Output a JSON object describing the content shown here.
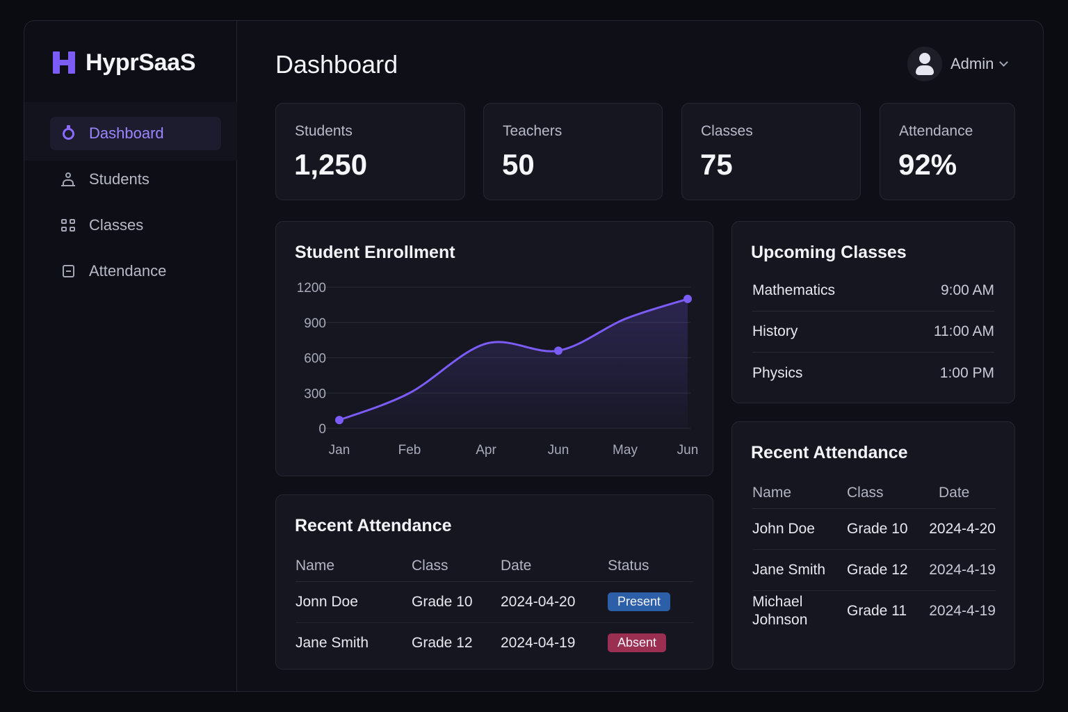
{
  "brand": {
    "name": "HyprSaaS"
  },
  "sidebar": {
    "items": [
      {
        "label": "Dashboard",
        "icon": "dashboard-icon",
        "active": true
      },
      {
        "label": "Students",
        "icon": "user-icon"
      },
      {
        "label": "Classes",
        "icon": "grid-icon"
      },
      {
        "label": "Attendance",
        "icon": "document-icon"
      }
    ]
  },
  "header": {
    "title": "Dashboard",
    "user": "Admin"
  },
  "stats": [
    {
      "label": "Students",
      "value": "1,250"
    },
    {
      "label": "Teachers",
      "value": "50"
    },
    {
      "label": "Classes",
      "value": "75"
    },
    {
      "label": "Attendance",
      "value": "92%"
    }
  ],
  "chart_data": {
    "type": "line",
    "title": "Student Enrollment",
    "categories": [
      "Jan",
      "Feb",
      "Apr",
      "Jun",
      "May",
      "Jun"
    ],
    "values": [
      70,
      300,
      720,
      660,
      930,
      1100
    ],
    "ylim": [
      0,
      1200
    ],
    "yticks": [
      "1200",
      "900",
      "600",
      "300",
      "0"
    ],
    "grid": true,
    "color": "#7c5cf6"
  },
  "recent_attendance_main": {
    "title": "Recent Attendance",
    "columns": [
      "Name",
      "Class",
      "Date",
      "Status"
    ],
    "rows": [
      {
        "name": "Jonn Doe",
        "class": "Grade 10",
        "date": "2024-04-20",
        "status": "Present",
        "status_color": "#2d5fa8"
      },
      {
        "name": "Jane Smith",
        "class": "Grade 12",
        "date": "2024-04-19",
        "status": "Absent",
        "status_color": "#9b2f52"
      }
    ]
  },
  "upcoming": {
    "title": "Upcoming Classes",
    "items": [
      {
        "subject": "Mathematics",
        "time": "9:00 AM"
      },
      {
        "subject": "History",
        "time": "11:00 AM"
      },
      {
        "subject": "Physics",
        "time": "1:00 PM"
      }
    ]
  },
  "recent_attendance_side": {
    "title": "Recent Attendance",
    "columns": [
      "Name",
      "Class",
      "Date"
    ],
    "rows": [
      {
        "name": "John Doe",
        "class": "Grade 10",
        "date": "2024-4-20"
      },
      {
        "name": "Jane Smith",
        "class": "Grade 12",
        "date": "2024-4-19"
      },
      {
        "name": "Michael Johnson",
        "class": "Grade 11",
        "date": "2024-4-19"
      }
    ]
  }
}
